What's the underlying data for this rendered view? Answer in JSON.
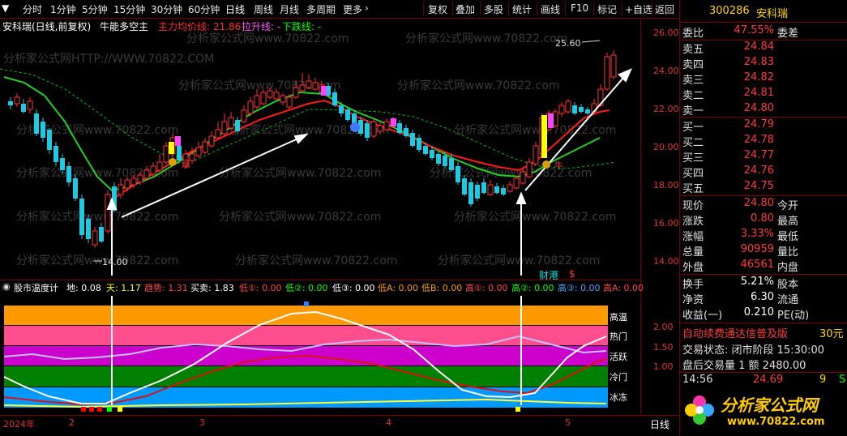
{
  "toolbar": {
    "items": [
      "分时",
      "1分钟",
      "5分钟",
      "15分钟",
      "30分钟",
      "60分钟",
      "日线",
      "周线",
      "月线",
      "多周期",
      "更多"
    ],
    "right_items": [
      "复权",
      "叠加",
      "多股",
      "统计",
      "画线",
      "F10",
      "标记",
      "+自选",
      "返回"
    ]
  },
  "infoline": {
    "stock": "安科瑞(日线,前复权)",
    "indicator": "牛能多空主",
    "main_label": "主力均价线: 21.86",
    "up_label": "拉升线: -",
    "down_label": "下跌线: -"
  },
  "watermark": "分析家公式网www.70822.com",
  "watermark2": "分析家公式网HTTP://WWW.70822.COM",
  "chart": {
    "high_label": "25.60",
    "low_label": "14.00",
    "y_ticks": [
      "26.00",
      "24.00",
      "22.00",
      "20.00",
      "18.00",
      "16.00",
      "14.00"
    ],
    "markers": {
      "cai": "财",
      "zhang": "涨",
      "shen": "$"
    }
  },
  "indicator": {
    "title": "股市温度计",
    "values": [
      "地: 0.08",
      "天: 1.17",
      "趋势: 1.31",
      "买卖: 1.83",
      "低①: 0.00",
      "低②: 0.00",
      "低③: 0.00",
      "低A: 0.00",
      "低B: 0.00",
      "高①: 0.00",
      "高②: 0.00",
      "高③: 0.00",
      "高A: 0.00"
    ],
    "bands": [
      "高温",
      "热门",
      "活跃",
      "冷门",
      "冰冻"
    ],
    "y_ticks": [
      "2.00",
      "1.50",
      "1.00"
    ],
    "band_colors": [
      "#ff9900",
      "#ff4d8d",
      "#cc00cc",
      "#008000",
      "#0099ff"
    ]
  },
  "xaxis": {
    "labels": [
      "2024年",
      "2",
      "3",
      "4",
      "5"
    ],
    "period": "日线"
  },
  "quote": {
    "code": "300286",
    "name": "安科瑞",
    "weibi_label": "委比",
    "weibi": "47.55%",
    "weicha_label": "委差",
    "sell": [
      {
        "label": "卖五",
        "price": "24.84"
      },
      {
        "label": "卖四",
        "price": "24.83"
      },
      {
        "label": "卖三",
        "price": "24.82"
      },
      {
        "label": "卖二",
        "price": "24.81"
      },
      {
        "label": "卖一",
        "price": "24.80"
      }
    ],
    "buy": [
      {
        "label": "买一",
        "price": "24.79"
      },
      {
        "label": "买二",
        "price": "24.78"
      },
      {
        "label": "买三",
        "price": "24.77"
      },
      {
        "label": "买四",
        "price": "24.76"
      },
      {
        "label": "买五",
        "price": "24.75"
      }
    ],
    "stats": [
      {
        "l": "现价",
        "v": "24.80",
        "l2": "今开"
      },
      {
        "l": "涨跌",
        "v": "0.80",
        "l2": "最高"
      },
      {
        "l": "涨幅",
        "v": "3.33%",
        "l2": "最低"
      },
      {
        "l": "总量",
        "v": "90959",
        "l2": "量比"
      },
      {
        "l": "外盘",
        "v": "46561",
        "l2": "内盘"
      }
    ],
    "stats2": [
      {
        "l": "换手",
        "v": "5.21%",
        "l2": "股本"
      },
      {
        "l": "净资",
        "v": "6.30",
        "l2": "流通"
      },
      {
        "l": "收益(一)",
        "v": "0.210",
        "l2": "PE(动)"
      }
    ],
    "promo": "自动续费通达信普及版",
    "promo_tail": "30元",
    "trade_status": "交易状态: 闭市阶段 15:30:00",
    "after_hours": "盘后交易量 1 额 2480.00",
    "tick_time": "14:56",
    "tick_price": "24.69",
    "tick_vol": "9",
    "tick_dir": "S"
  },
  "logo": {
    "text": "分析家公式网",
    "url": "www.70822.com"
  }
}
